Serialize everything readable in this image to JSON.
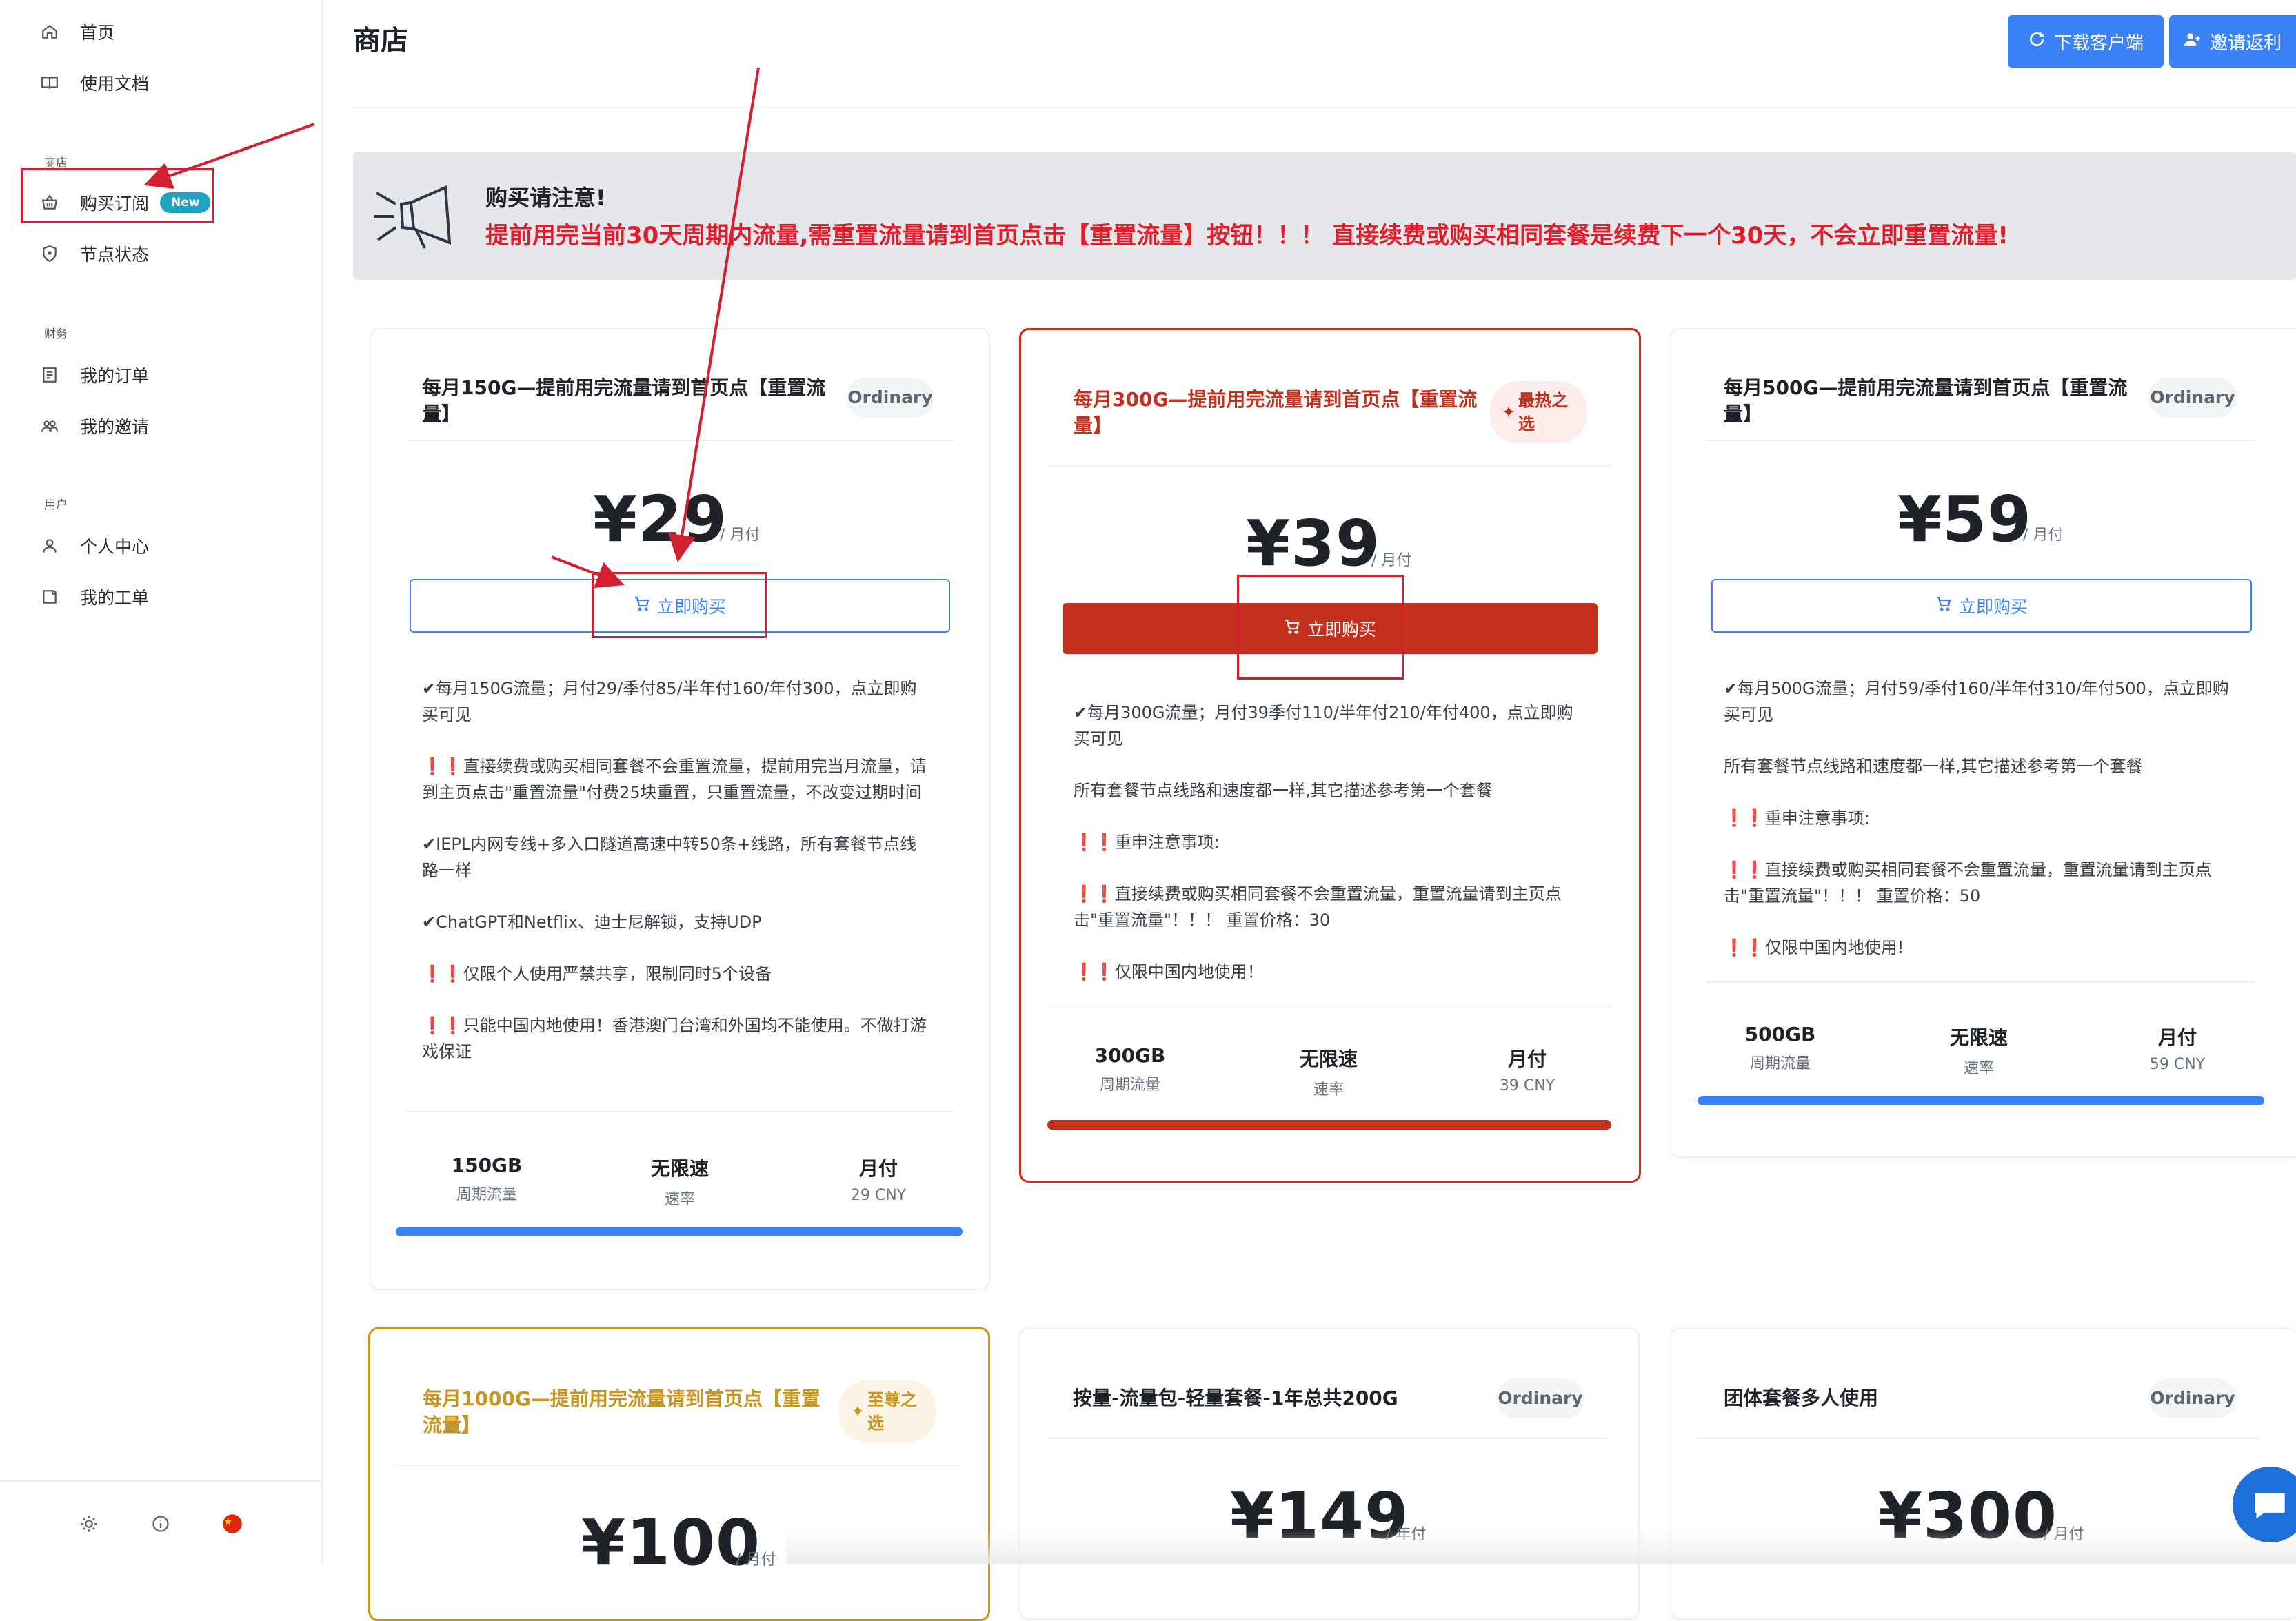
{
  "sidebar": {
    "nav": [
      {
        "label": "首页",
        "icon": "home-icon"
      },
      {
        "label": "使用文档",
        "icon": "book-icon"
      }
    ],
    "section_shop": "商店",
    "shop_items": [
      {
        "label": "购买订阅",
        "icon": "basket-icon",
        "badge": "New"
      },
      {
        "label": "节点状态",
        "icon": "shield-icon"
      }
    ],
    "section_finance": "财务",
    "finance_items": [
      {
        "label": "我的订单",
        "icon": "order-icon"
      },
      {
        "label": "我的邀请",
        "icon": "users-icon"
      }
    ],
    "section_user": "用户",
    "user_items": [
      {
        "label": "个人中心",
        "icon": "user-icon"
      },
      {
        "label": "我的工单",
        "icon": "ticket-icon"
      }
    ],
    "footer_icons": [
      "theme-toggle-icon",
      "info-icon",
      "language-flag-icon"
    ]
  },
  "header": {
    "title": "商店",
    "download_label": "下载客户端",
    "invite_label": "邀请返利"
  },
  "notice": {
    "title": "购买请注意!",
    "body": "提前用完当前30天周期内流量,需重置流量请到首页点击【重置流量】按钮！！！ 直接续费或购买相同套餐是续费下一个30天，不会立即重置流量!"
  },
  "buy_label": "立即购买",
  "plans": [
    {
      "title": "每月150G—提前用完流量请到首页点【重置流量】",
      "tag": "Ordinary",
      "price": "¥29",
      "period": "/ 月付",
      "desc": [
        "✔每月150G流量；月付29/季付85/半年付160/年付300，点立即购买可见",
        "❗❗直接续费或购买相同套餐不会重置流量，提前用完当月流量，请到主页点击\"重置流量\"付费25块重置，只重置流量，不改变过期时间",
        "✔IEPL内网专线+多入口隧道高速中转50条+线路，所有套餐节点线路一样",
        "✔ChatGPT和Netflix、迪士尼解锁，支持UDP",
        "❗❗仅限个人使用严禁共享，限制同时5个设备",
        "❗❗只能中国内地使用！香港澳门台湾和外国均不能使用。不做打游戏保证"
      ],
      "stats": [
        {
          "v": "150GB",
          "l": "周期流量"
        },
        {
          "v": "无限速",
          "l": "速率"
        },
        {
          "v": "月付",
          "l": "29 CNY"
        }
      ]
    },
    {
      "title": "每月300G—提前用完流量请到首页点【重置流量】",
      "tag": "最热之选",
      "price": "¥39",
      "period": "/ 月付",
      "desc": [
        "✔每月300G流量；月付39季付110/半年付210/年付400，点立即购买可见",
        "所有套餐节点线路和速度都一样,其它描述参考第一个套餐",
        "❗❗重申注意事项:",
        "❗❗直接续费或购买相同套餐不会重置流量，重置流量请到主页点击\"重置流量\"！！！ 重置价格：30",
        "❗❗仅限中国内地使用！"
      ],
      "stats": [
        {
          "v": "300GB",
          "l": "周期流量"
        },
        {
          "v": "无限速",
          "l": "速率"
        },
        {
          "v": "月付",
          "l": "39 CNY"
        }
      ]
    },
    {
      "title": "每月500G—提前用完流量请到首页点【重置流量】",
      "tag": "Ordinary",
      "price": "¥59",
      "period": "/ 月付",
      "desc": [
        "✔每月500G流量；月付59/季付160/半年付310/年付500，点立即购买可见",
        "所有套餐节点线路和速度都一样,其它描述参考第一个套餐",
        "❗❗重申注意事项:",
        "❗❗直接续费或购买相同套餐不会重置流量，重置流量请到主页点击\"重置流量\"！！！ 重置价格：50",
        "❗❗仅限中国内地使用!"
      ],
      "stats": [
        {
          "v": "500GB",
          "l": "周期流量"
        },
        {
          "v": "无限速",
          "l": "速率"
        },
        {
          "v": "月付",
          "l": "59 CNY"
        }
      ]
    },
    {
      "title": "每月1000G—提前用完流量请到首页点【重置流量】",
      "tag": "至尊之选",
      "price": "¥100",
      "period": "/ 月付"
    },
    {
      "title": "按量-流量包-轻量套餐-1年总共200G",
      "tag": "Ordinary",
      "price": "¥149",
      "period": "/ 年付"
    },
    {
      "title": "团体套餐多人使用",
      "tag": "Ordinary",
      "price": "¥300",
      "period": "/ 月付"
    }
  ],
  "colors": {
    "accent": "#3b82f6",
    "hot": "#c4301c",
    "premium": "#c8961e",
    "alert": "#e11d2c",
    "annotation": "#d32030"
  }
}
